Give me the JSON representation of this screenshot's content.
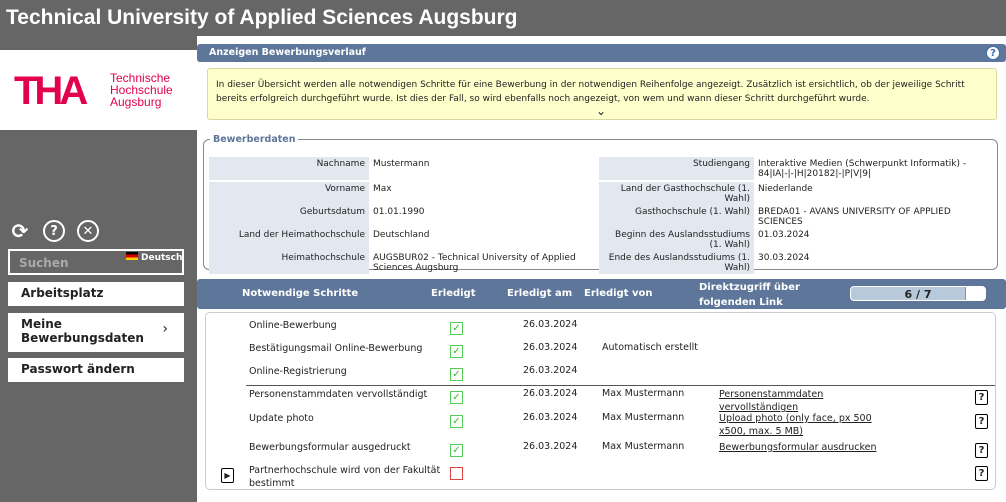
{
  "header": {
    "title": "Technical University of Applied Sciences Augsburg"
  },
  "sidebar": {
    "logo": {
      "mark": "THA",
      "text": [
        "Technische",
        "Hochschule",
        "Augsburg"
      ]
    },
    "icons": [
      "refresh-icon",
      "help-icon",
      "close-icon"
    ],
    "search_placeholder": "Suchen",
    "language": "Deutsch",
    "items": [
      {
        "label": "Arbeitsplatz"
      },
      {
        "label": "Meine Bewerbungsdaten",
        "has_submenu": true
      },
      {
        "label": "Passwort ändern"
      }
    ]
  },
  "section": {
    "title": "Anzeigen Bewerbungsverlauf"
  },
  "info": "In dieser Übersicht werden alle notwendigen Schritte für eine Bewerbung in der notwendigen Reihenfolge angezeigt. Zusätzlich ist ersichtlich, ob der jeweilige Schritt bereits erfolgreich durchgeführt wurde. Ist dies der Fall, so wird ebenfalls noch angezeigt, von wem und wann dieser Schritt durchgeführt wurde.",
  "applicant": {
    "legend": "Bewerberdaten",
    "left": [
      {
        "k": "Nachname",
        "v": "Mustermann"
      },
      {
        "k": "Vorname",
        "v": "Max"
      },
      {
        "k": "Geburtsdatum",
        "v": "01.01.1990"
      },
      {
        "k": "Land der Heimathochschule",
        "v": "Deutschland"
      },
      {
        "k": "Heimathochschule",
        "v": "AUGSBUR02 - Technical University of Applied Sciences Augsburg"
      }
    ],
    "right": [
      {
        "k": "Studiengang",
        "v": "Interaktive Medien (Schwerpunkt Informatik) - 84|IA|-|-|H|20182|-|P|V|9|"
      },
      {
        "k": "Land der Gasthochschule (1. Wahl)",
        "v": "Niederlande"
      },
      {
        "k": "Gasthochschule (1. Wahl)",
        "v": "BREDA01 - AVANS UNIVERSITY OF APPLIED SCIENCES"
      },
      {
        "k": "Beginn des Auslandsstudiums (1. Wahl)",
        "v": "01.03.2024"
      },
      {
        "k": "Ende des Auslandsstudiums (1. Wahl)",
        "v": "30.03.2024"
      }
    ]
  },
  "steps": {
    "headers": {
      "step": "Notwendige Schritte",
      "done": "Erledigt",
      "date": "Erledigt am",
      "by": "Erledigt von",
      "link": "Direktzugriff über folgenden Link"
    },
    "progress": {
      "label": "6 / 7",
      "fraction": 0.857
    },
    "rows": [
      {
        "step": "Online-Bewerbung",
        "done": true,
        "date": "26.03.2024",
        "by": "",
        "link": "",
        "help": false
      },
      {
        "step": "Bestätigungsmail Online-Bewerbung",
        "done": true,
        "date": "26.03.2024",
        "by": "Automatisch erstellt",
        "link": "",
        "help": false
      },
      {
        "step": "Online-Registrierung",
        "done": true,
        "date": "26.03.2024",
        "by": "",
        "link": "",
        "help": false
      },
      {
        "step": "Personenstammdaten vervollständigt",
        "done": true,
        "date": "26.03.2024",
        "by": "Max Mustermann",
        "link": "Personenstammdaten vervollständigen",
        "help": true
      },
      {
        "step": "Update photo",
        "done": true,
        "date": "26.03.2024",
        "by": "Max Mustermann",
        "link": "Upload photo (only face, px 500 x500, max. 5 MB)",
        "help": true
      },
      {
        "step": "Bewerbungsformular ausgedruckt",
        "done": true,
        "date": "26.03.2024",
        "by": "Max Mustermann",
        "link": "Bewerbungsformular ausdrucken",
        "help": true
      },
      {
        "step": "Partnerhochschule wird von der Fakultät bestimmt",
        "done": false,
        "date": "",
        "by": "",
        "link": "",
        "help": true,
        "current": true
      }
    ]
  },
  "colors": {
    "header_bg": "#666666",
    "accent": "#5d7699",
    "logo": "#e2004f",
    "info_bg": "#ffffcc"
  }
}
